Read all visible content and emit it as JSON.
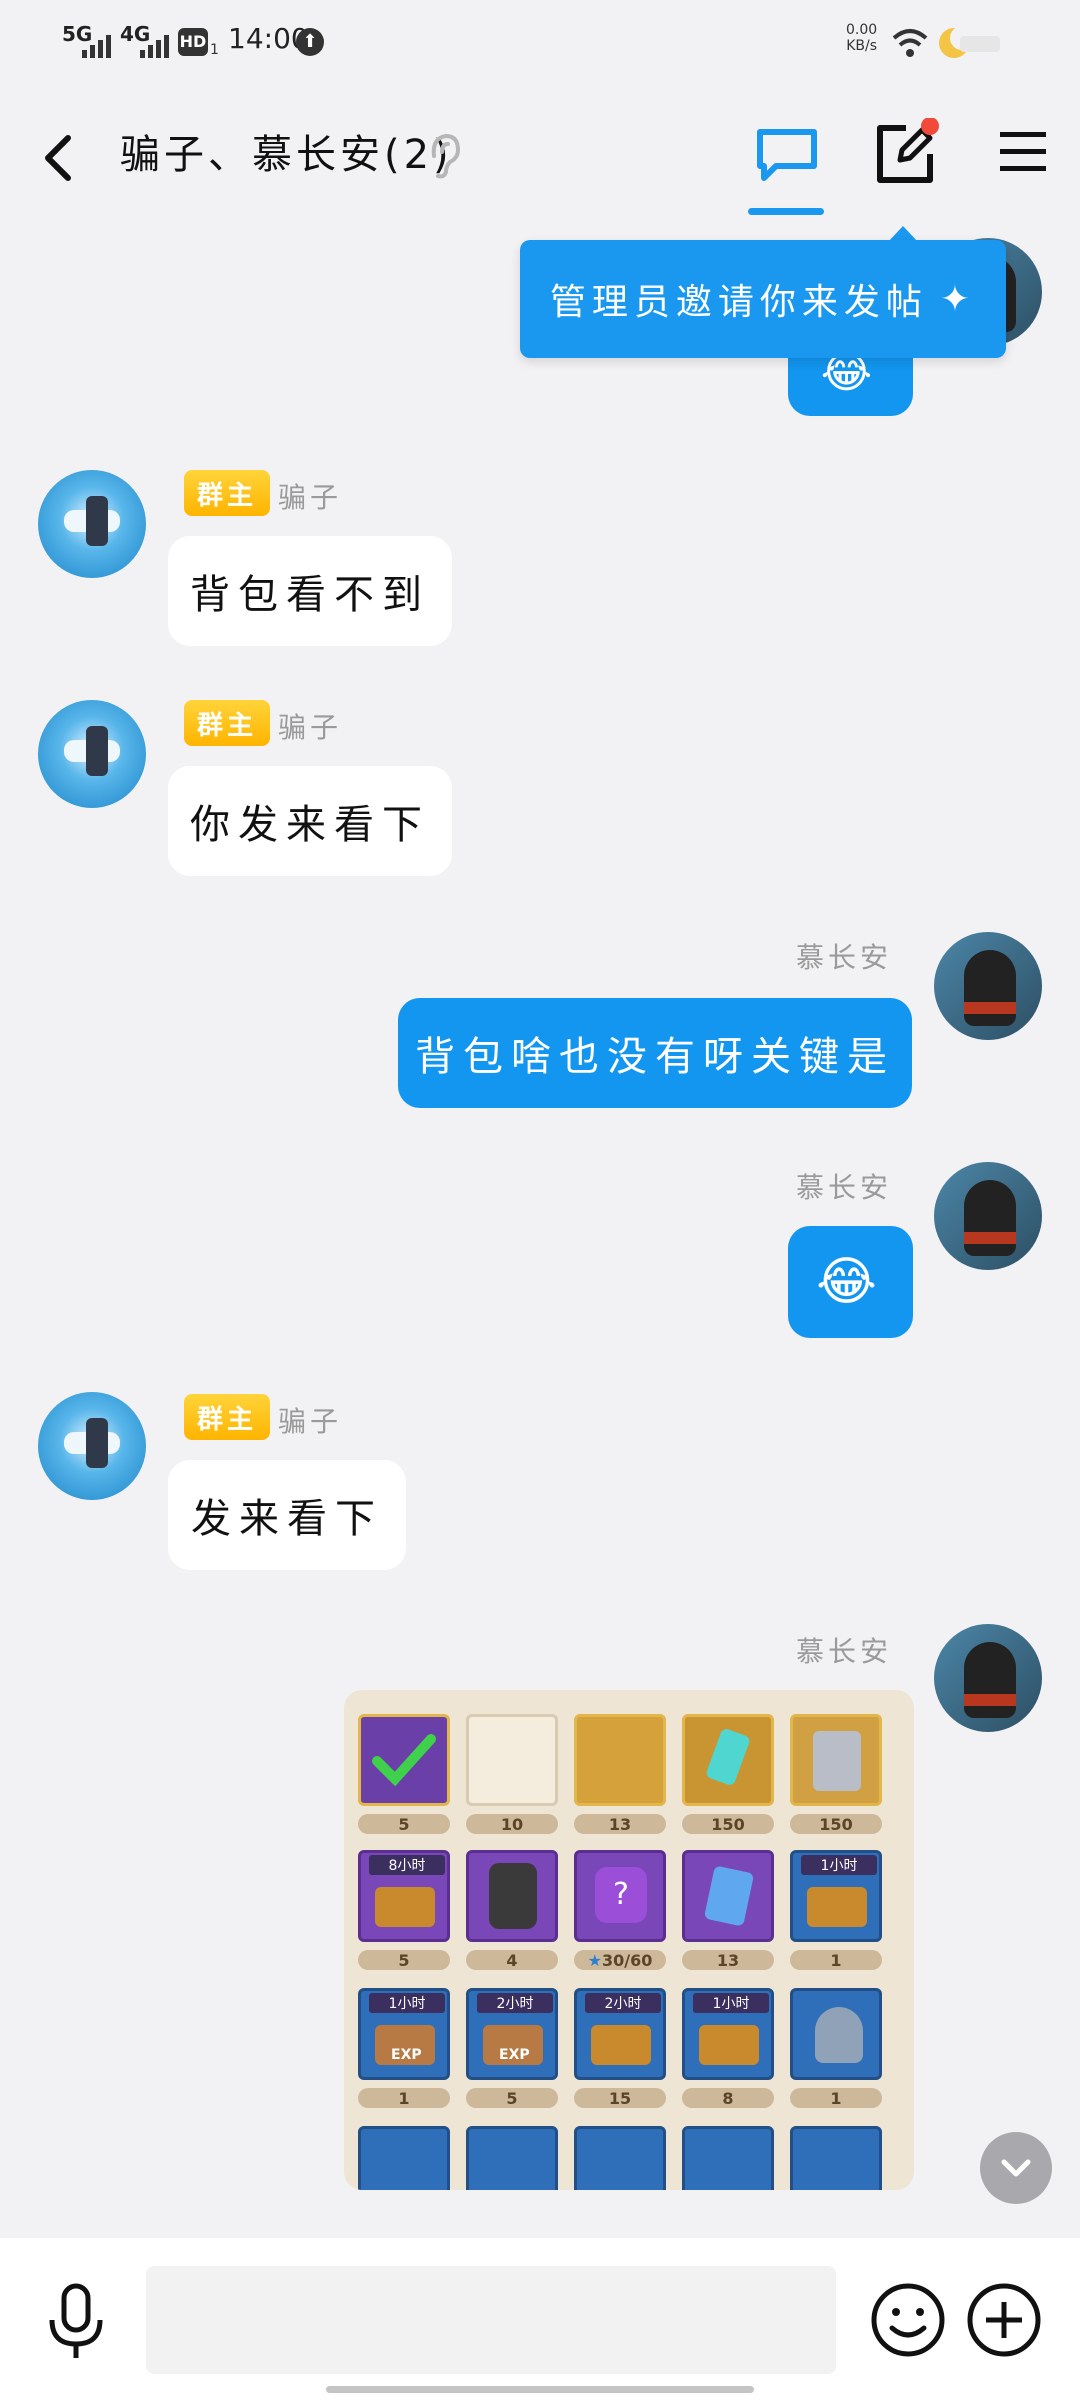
{
  "status_bar": {
    "time": "14:00",
    "net1": "5G",
    "net2": "4G",
    "hd": "HD",
    "hd_sub": "1",
    "speed_value": "0.00",
    "speed_unit": "KB/s"
  },
  "header": {
    "title": "骗子、慕长安(2)"
  },
  "popup": {
    "text": "管理员邀请你来发帖"
  },
  "messages": [
    {
      "side": "in",
      "role_badge": "群主",
      "sender": "骗子",
      "text": "背包看不到"
    },
    {
      "side": "in",
      "role_badge": "群主",
      "sender": "骗子",
      "text": "你发来看下"
    },
    {
      "side": "out",
      "sender": "慕长安",
      "text": "背包啥也没有呀关键是"
    },
    {
      "side": "out",
      "sender": "慕长安",
      "emoji": "😂"
    },
    {
      "side": "in",
      "role_badge": "群主",
      "sender": "骗子",
      "text": "发来看下"
    },
    {
      "side": "out",
      "sender": "慕长安",
      "image": "inventory-screenshot"
    }
  ],
  "inventory": {
    "row1": [
      "5",
      "10",
      "13",
      "150",
      "150"
    ],
    "row2": [
      "5",
      "4",
      "30/60",
      "13",
      "1"
    ],
    "row3": [
      "1",
      "5",
      "15",
      "8",
      "1"
    ],
    "timers_row2": [
      "8小时",
      "",
      "",
      "",
      "1小时"
    ],
    "timers_row3": [
      "1小时",
      "2小时",
      "2小时",
      "1小时",
      ""
    ],
    "exp_label": "EXP"
  },
  "colors": {
    "accent": "#1296f0",
    "badge": "#ffc21a",
    "background": "#f2f2f4",
    "notification_dot": "#f24a3a"
  },
  "icons": {
    "back": "chevron-left-icon",
    "chat_tab": "chat-bubble-icon",
    "compose": "edit-icon",
    "menu": "hamburger-menu-icon",
    "voice": "microphone-icon",
    "emoji": "smiley-icon",
    "more": "plus-circle-icon",
    "scroll_down": "chevron-down-icon"
  }
}
